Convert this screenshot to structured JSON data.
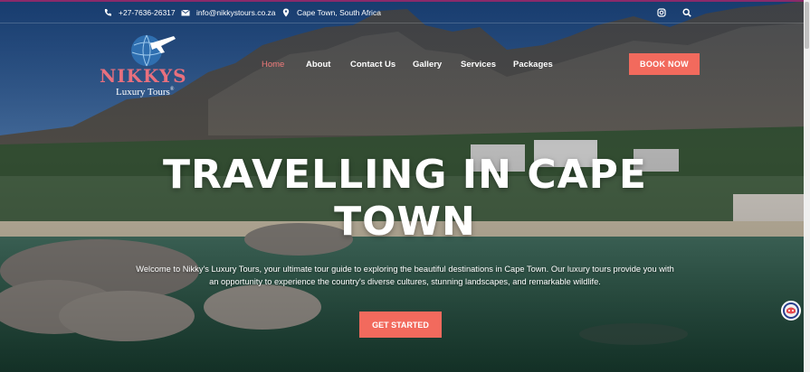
{
  "topbar": {
    "phone": "+27-7636-26317",
    "email": "info@nikkystours.co.za",
    "location": "Cape Town, South Africa",
    "icons": [
      "phone-icon",
      "mail-icon",
      "location-pin-icon",
      "instagram-icon",
      "search-icon"
    ]
  },
  "logo": {
    "brand": "NIKKYS",
    "tagline": "Luxury Tours",
    "registered": "®"
  },
  "nav": {
    "items": [
      {
        "label": "Home",
        "active": true
      },
      {
        "label": "About",
        "active": false
      },
      {
        "label": "Contact Us",
        "active": false
      },
      {
        "label": "Gallery",
        "active": false
      },
      {
        "label": "Services",
        "active": false
      },
      {
        "label": "Packages",
        "active": false
      }
    ],
    "book_label": "BOOK NOW"
  },
  "hero": {
    "headline_line1": "TRAVELLING IN CAPE",
    "headline_line2": "TOWN",
    "intro": "Welcome to Nikky's Luxury Tours, your ultimate tour guide to exploring the beautiful destinations in Cape Town. Our luxury tours provide you with an opportunity to experience the country's diverse cultures, stunning landscapes, and remarkable wildlife.",
    "cta_label": "GET STARTED"
  },
  "colors": {
    "accent": "#f26a5d",
    "brand_pink": "#e8707e",
    "active_nav": "#f07a7a",
    "topbar_border": "#8a2a6a"
  }
}
